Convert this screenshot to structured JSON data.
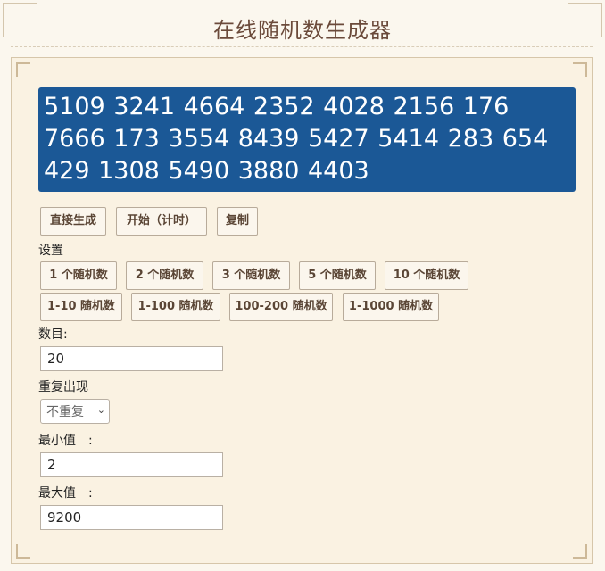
{
  "header": {
    "title": "在线随机数生成器"
  },
  "result": {
    "text": "5109 3241 4664 2352 4028 2156 176 7666 173 3554 8439 5427 5414 283 654 429 1308 5490 3880 4403"
  },
  "actions": {
    "generate": "直接生成",
    "start_timed": "开始（计时）",
    "copy": "复制"
  },
  "settings": {
    "heading": "设置",
    "count_presets": [
      "1 个随机数",
      "2 个随机数",
      "3 个随机数",
      "5 个随机数",
      "10 个随机数"
    ],
    "range_presets": [
      "1-10 随机数",
      "1-100 随机数",
      "100-200 随机数",
      "1-1000 随机数"
    ],
    "count_label": "数目:",
    "count_value": "20",
    "repeat_label": "重复出现",
    "repeat_value": "不重复",
    "min_label": "最小值　:",
    "min_value": "2",
    "max_label": "最大值　:",
    "max_value": "9200"
  },
  "icons": {
    "select": "chevron-down-icon"
  }
}
